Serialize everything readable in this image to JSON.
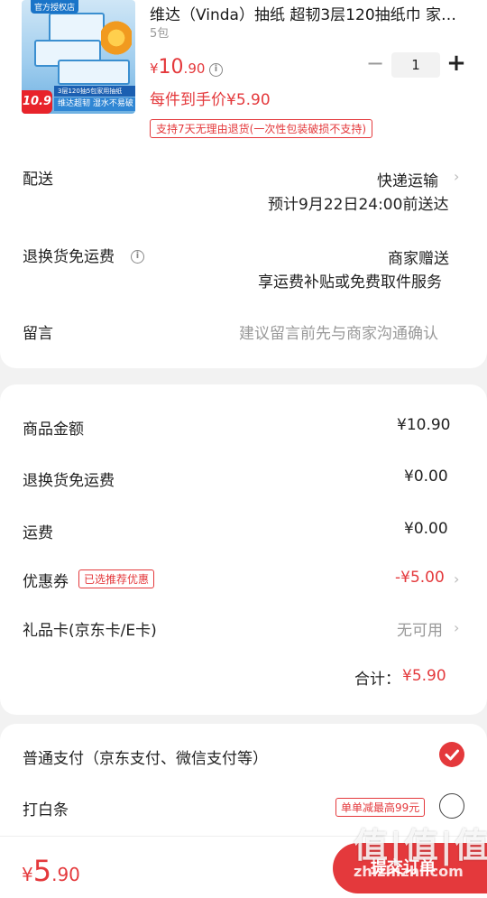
{
  "product": {
    "image": {
      "official_tag": "官方授权店",
      "strip_text": "3层120抽5包家用抽纸",
      "strip2_text": "维达超韧 湿水不易破",
      "badge_price": "10.9"
    },
    "title": "维达（Vinda）抽纸 超韧3层120抽纸巾 家…",
    "spec": "5包",
    "price_currency": "¥",
    "price_int": "10",
    "price_dec": ".90",
    "final_price_label": "每件到手价¥5.90",
    "return_policy": "支持7天无理由退货(一次性包装破损不支持)",
    "qty": "1",
    "minus_label": "−",
    "plus_label": "+"
  },
  "delivery": {
    "label": "配送",
    "method": "快递运输",
    "eta": "预计9月22日24:00前送达"
  },
  "return_shipping": {
    "label": "退换货免运费",
    "value": "商家赠送",
    "desc": "享运费补贴或免费取件服务"
  },
  "message": {
    "label": "留言",
    "placeholder": "建议留言前先与商家沟通确认"
  },
  "costs": {
    "goods_label": "商品金额",
    "goods_value": "¥10.90",
    "return_label": "退换货免运费",
    "return_value": "¥0.00",
    "shipping_label": "运费",
    "shipping_value": "¥0.00",
    "coupon_label": "优惠券",
    "coupon_tag": "已选推荐优惠",
    "coupon_value": "-¥5.00",
    "giftcard_label": "礼品卡(京东卡/E卡)",
    "giftcard_value": "无可用",
    "subtotal_label": "合计：",
    "subtotal_value": "¥5.90"
  },
  "payment": {
    "normal_label": "普通支付（京东支付、微信支付等）",
    "baitiao_label": "打白条",
    "baitiao_promo": "单单减最高99元"
  },
  "footer": {
    "currency": "¥",
    "total_int": "5",
    "total_dec": ".90",
    "submit_label": "提交订单"
  },
  "watermark": {
    "top": "值|值|值",
    "sub": "zhizhizhi.com"
  },
  "colors": {
    "accent": "#e4393c",
    "background": "#f2f2f2"
  },
  "icons": [
    "info-icon",
    "chevron-right-icon",
    "checkmark-icon",
    "radio-empty-icon"
  ]
}
